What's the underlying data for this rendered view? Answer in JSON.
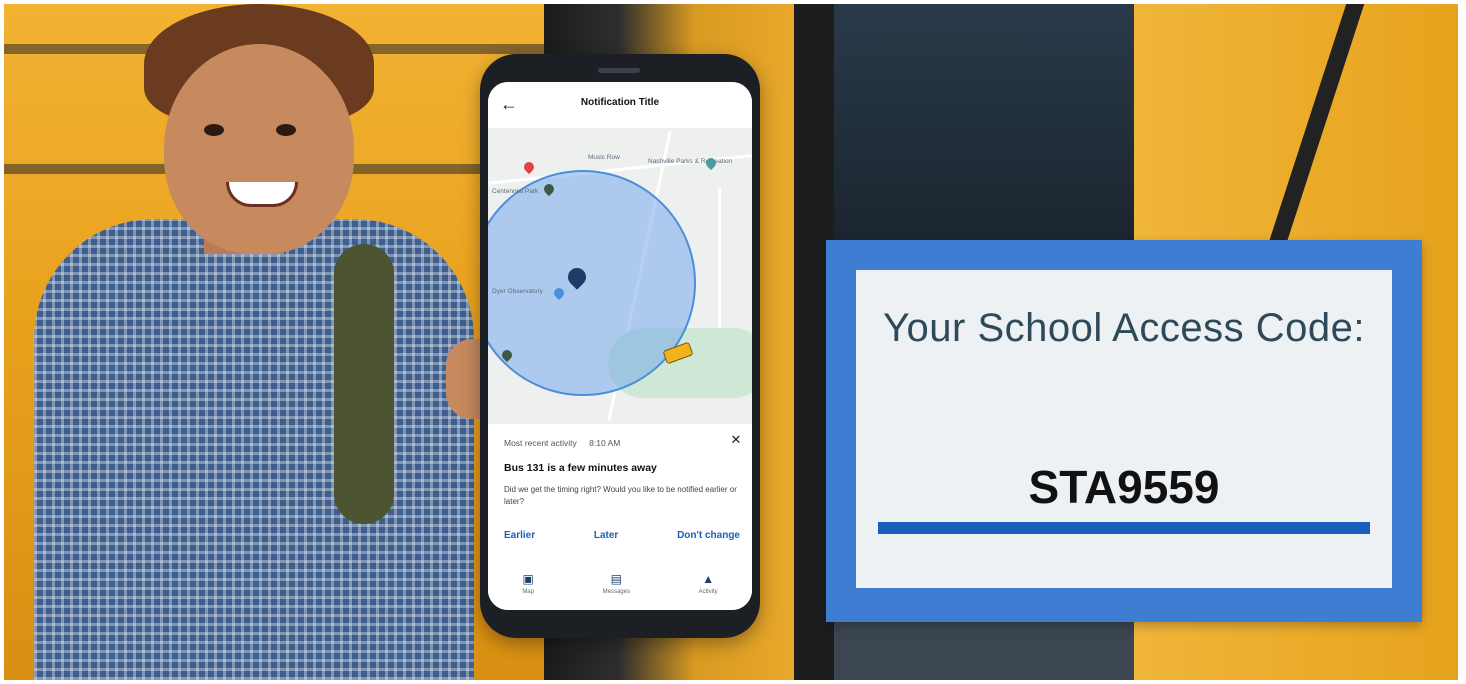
{
  "phone": {
    "header": {
      "title": "Notification Title"
    },
    "map": {
      "labels": [
        "Nashville Parks & Recreation",
        "Centennial Park",
        "Music Row",
        "Dyer Observatory"
      ]
    },
    "notification": {
      "recent_label": "Most recent activity",
      "recent_time": "8:10 AM",
      "title": "Bus 131 is a few minutes away",
      "question": "Did we get the timing right? Would you like to be notified earlier or later?",
      "actions": {
        "earlier": "Earlier",
        "later": "Later",
        "dont_change": "Don't change"
      }
    },
    "bottom_nav": [
      {
        "label": "Map",
        "icon": "map-icon"
      },
      {
        "label": "Messages",
        "icon": "messages-icon"
      },
      {
        "label": "Activity",
        "icon": "bell-icon"
      }
    ]
  },
  "access_card": {
    "heading": "Your School Access Code:",
    "code": "STA9559"
  },
  "colors": {
    "accent_blue": "#3d7dd2",
    "code_bar": "#1a5fbe",
    "bus_yellow": "#f2b233",
    "action_blue": "#1d5fb8"
  }
}
